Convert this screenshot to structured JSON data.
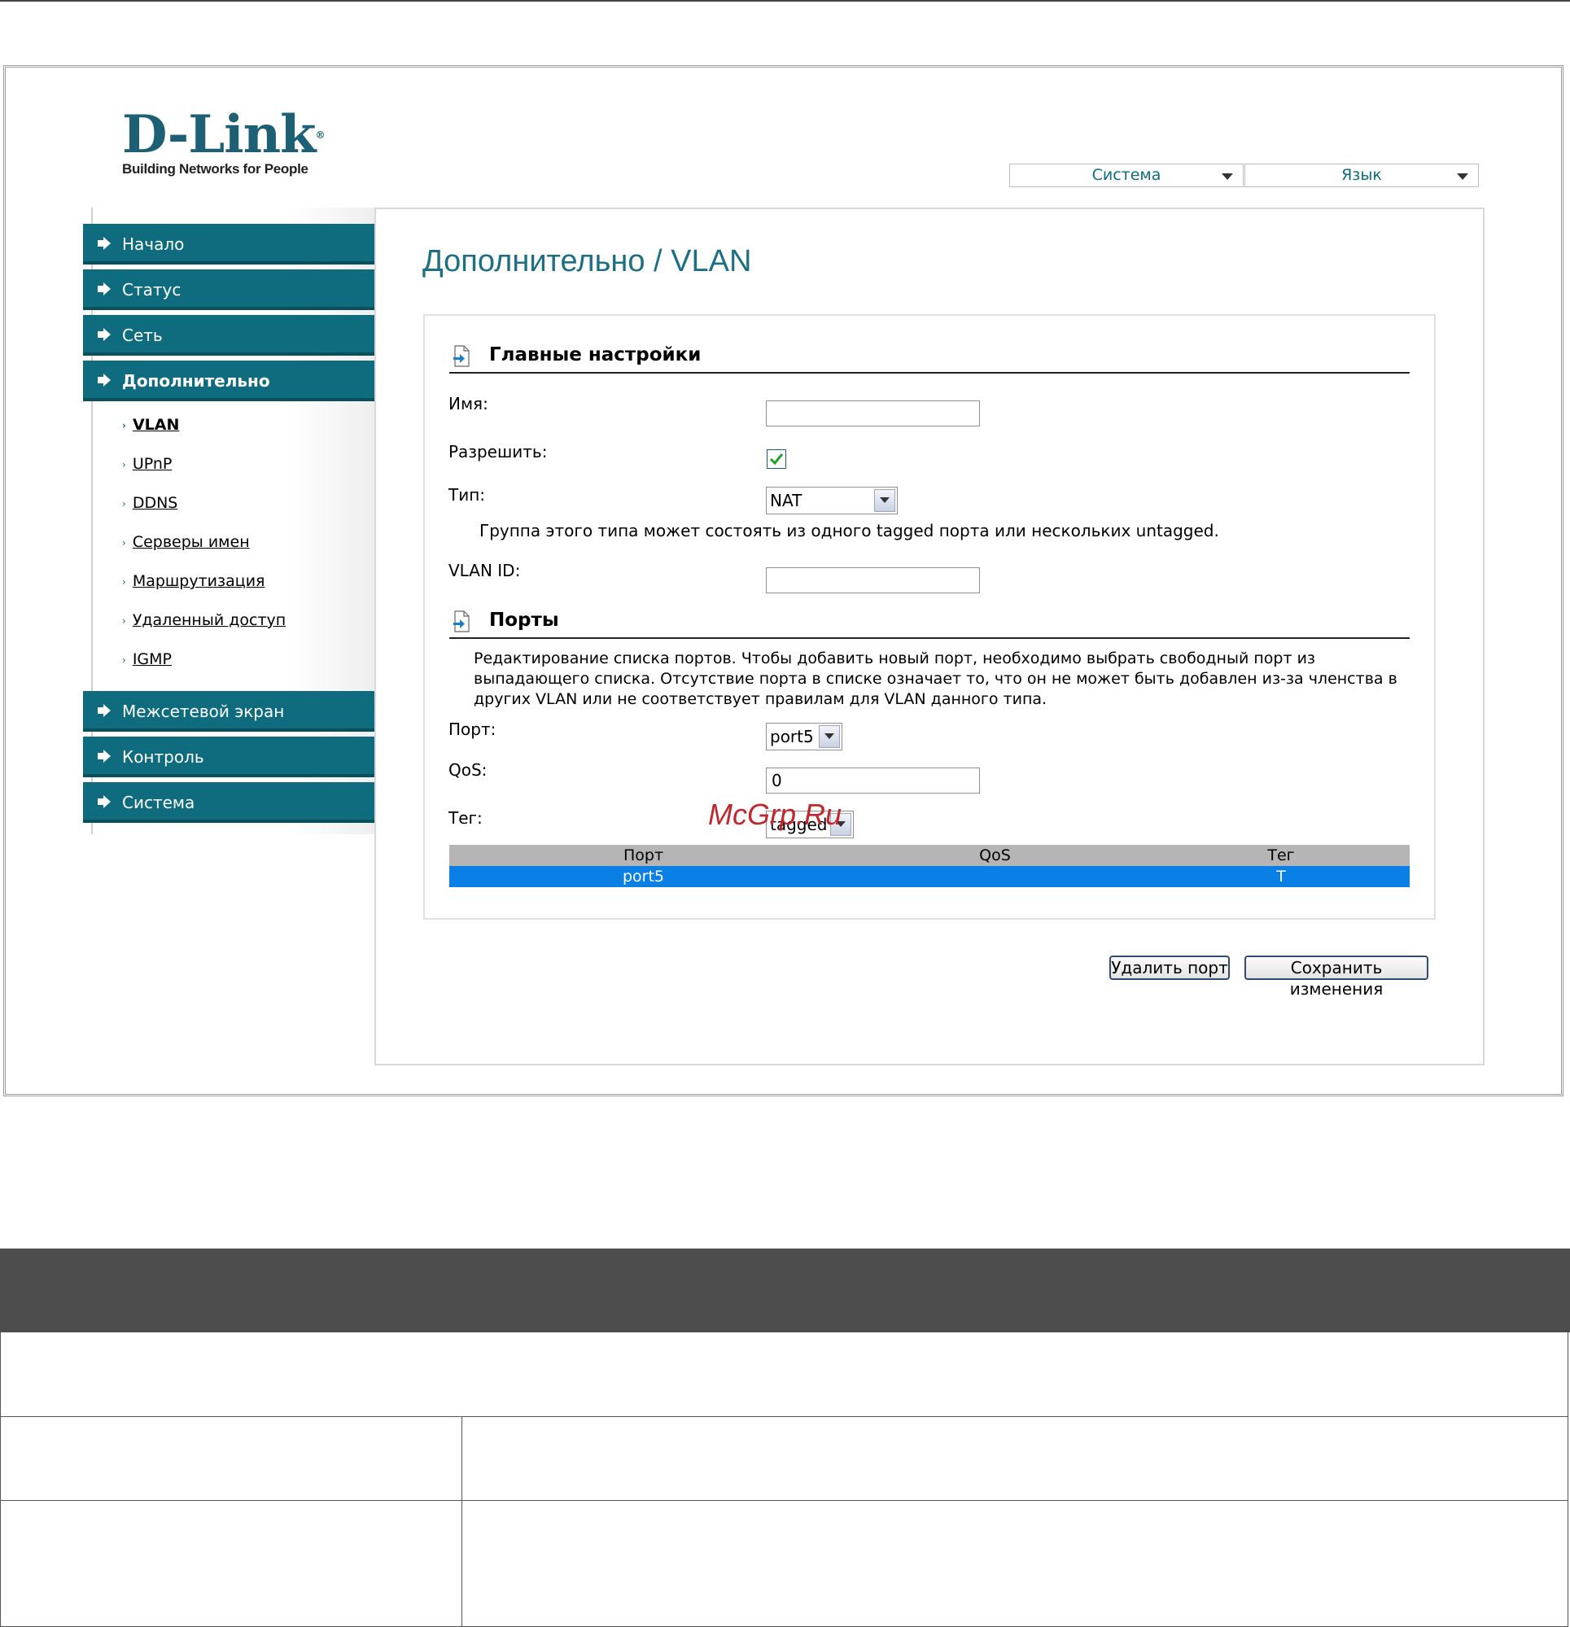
{
  "logo": {
    "brand": "D-Link",
    "tagline": "Building Networks for People",
    "reg": "®"
  },
  "header": {
    "system_menu": "Система",
    "language_menu": "Язык"
  },
  "sidebar": {
    "items": [
      {
        "label": "Начало"
      },
      {
        "label": "Статус"
      },
      {
        "label": "Сеть"
      },
      {
        "label": "Дополнительно"
      },
      {
        "label": "Межсетевой экран"
      },
      {
        "label": "Контроль"
      },
      {
        "label": "Система"
      }
    ],
    "subitems": [
      {
        "label": "VLAN"
      },
      {
        "label": "UPnP"
      },
      {
        "label": "DDNS"
      },
      {
        "label": "Серверы имен"
      },
      {
        "label": "Маршрутизация"
      },
      {
        "label": "Удаленный доступ"
      },
      {
        "label": "IGMP"
      }
    ]
  },
  "page": {
    "title": "Дополнительно /  VLAN"
  },
  "main_settings": {
    "heading": "Главные настройки",
    "name_label": "Имя:",
    "name_value": "",
    "enable_label": "Разрешить:",
    "enable_checked": true,
    "type_label": "Тип:",
    "type_value": "NAT",
    "type_hint": "Группа этого типа может состоять из одного tagged порта или нескольких untagged.",
    "vlan_id_label": "VLAN ID:",
    "vlan_id_value": ""
  },
  "ports": {
    "heading": "Порты",
    "description": "Редактирование списка портов. Чтобы добавить новый порт, необходимо выбрать свободный порт из выпадающего списка. Отсутствие порта в списке означает то, что он не может быть добавлен из-за членства в других VLAN или не соответствует правилам для VLAN данного типа.",
    "port_label": "Порт:",
    "port_value": "port5",
    "qos_label": "QoS:",
    "qos_value": "0",
    "tag_label": "Тег:",
    "tag_value": "tagged",
    "table": {
      "headers": [
        "Порт",
        "QoS",
        "Тег"
      ],
      "rows": [
        [
          "port5",
          "",
          "T"
        ]
      ]
    }
  },
  "actions": {
    "delete_port": "Удалить порт",
    "save": "Сохранить изменения"
  },
  "watermark": "McGrp.Ru",
  "colors": {
    "accent": "#0e6c7e",
    "selected_row": "#0a7fe6",
    "title": "#1d6f85"
  }
}
